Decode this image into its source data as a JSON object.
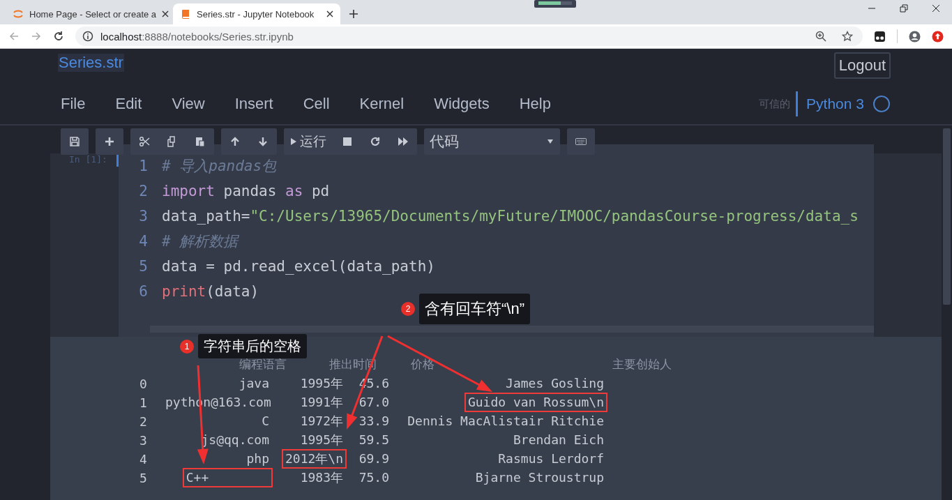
{
  "browser": {
    "tabs": [
      {
        "title": "Home Page - Select or create a",
        "selected": false
      },
      {
        "title": "Series.str - Jupyter Notebook",
        "selected": true
      }
    ],
    "address": {
      "host": "localhost",
      "path": ":8888/notebooks/Series.str.ipynb"
    }
  },
  "notebook": {
    "name": "Series.str",
    "logout": "Logout",
    "menu": [
      "File",
      "Edit",
      "View",
      "Insert",
      "Cell",
      "Kernel",
      "Widgets",
      "Help"
    ],
    "trusted": "可信的",
    "kernel": "Python 3",
    "kernel_busy": false
  },
  "toolbar": {
    "run": "运行",
    "cell_type": "代码"
  },
  "cell": {
    "prompt": "In [1]:",
    "lines": [
      {
        "number": "1",
        "tokens": [
          {
            "kind": "comment",
            "text": "# 导入pandas包"
          }
        ]
      },
      {
        "number": "2",
        "tokens": [
          {
            "kind": "keyword",
            "text": "import"
          },
          {
            "kind": "plain",
            "text": " pandas "
          },
          {
            "kind": "keyword",
            "text": "as"
          },
          {
            "kind": "plain",
            "text": " pd"
          }
        ]
      },
      {
        "number": "3",
        "tokens": [
          {
            "kind": "plain",
            "text": "data_path="
          },
          {
            "kind": "string",
            "text": "\"C:/Users/13965/Documents/myFuture/IMOOC/pandasCourse-progress/data_s"
          }
        ]
      },
      {
        "number": "4",
        "tokens": [
          {
            "kind": "comment",
            "text": "# 解析数据"
          }
        ]
      },
      {
        "number": "5",
        "tokens": [
          {
            "kind": "plain",
            "text": "data = pd.read_excel(data_path)"
          }
        ]
      },
      {
        "number": "6",
        "tokens": [
          {
            "kind": "builtin",
            "text": "print"
          },
          {
            "kind": "plain",
            "text": "(data)"
          }
        ]
      }
    ]
  },
  "output": {
    "headers": [
      "编程语言",
      "推出时间",
      "价格",
      "主要创始人"
    ],
    "rows": [
      {
        "index": "0",
        "cells": [
          {
            "text": "java",
            "highlighted": false
          },
          {
            "text": "1995年",
            "highlighted": false
          },
          {
            "text": "45.6",
            "highlighted": false
          },
          {
            "text": "James Gosling",
            "highlighted": false
          }
        ]
      },
      {
        "index": "1",
        "cells": [
          {
            "text": "python@163.com",
            "highlighted": false
          },
          {
            "text": "1991年",
            "highlighted": false
          },
          {
            "text": "67.0",
            "highlighted": false
          },
          {
            "text": "Guido van Rossum\\n",
            "highlighted": true
          }
        ]
      },
      {
        "index": "2",
        "cells": [
          {
            "text": "C",
            "highlighted": false
          },
          {
            "text": "1972年",
            "highlighted": false
          },
          {
            "text": "33.9",
            "highlighted": false
          },
          {
            "text": "Dennis MacAlistair Ritchie",
            "highlighted": false
          }
        ]
      },
      {
        "index": "3",
        "cells": [
          {
            "text": "js@qq.com",
            "highlighted": false
          },
          {
            "text": "1995年",
            "highlighted": false
          },
          {
            "text": "59.5",
            "highlighted": false
          },
          {
            "text": "Brendan Eich",
            "highlighted": false
          }
        ]
      },
      {
        "index": "4",
        "cells": [
          {
            "text": "php",
            "highlighted": false
          },
          {
            "text": "2012年\\n",
            "highlighted": true
          },
          {
            "text": "69.9",
            "highlighted": false
          },
          {
            "text": "Rasmus Lerdorf",
            "highlighted": false
          }
        ]
      },
      {
        "index": "5",
        "cells": [
          {
            "text": "C++        ",
            "highlighted": true
          },
          {
            "text": "1983年",
            "highlighted": false
          },
          {
            "text": "75.0",
            "highlighted": false
          },
          {
            "text": "Bjarne Stroustrup",
            "highlighted": false
          }
        ]
      }
    ]
  },
  "annotations": [
    {
      "number": "1",
      "text": "字符串后的空格"
    },
    {
      "number": "2",
      "text": "含有回车符“\\n”"
    }
  ]
}
